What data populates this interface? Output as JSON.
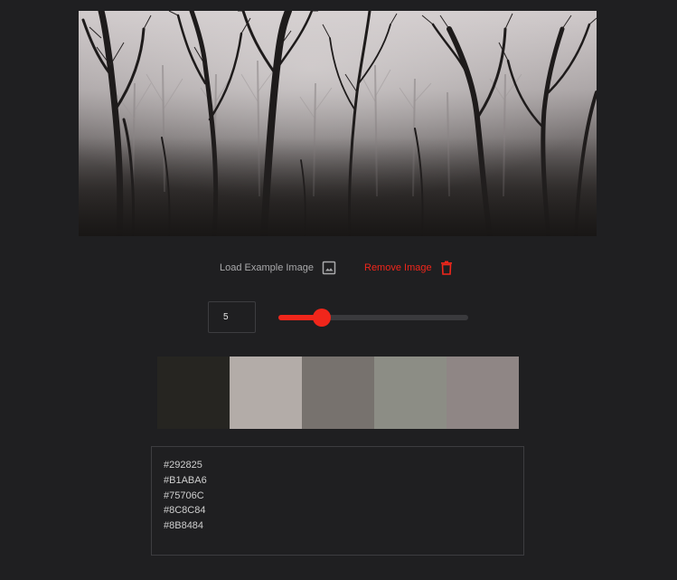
{
  "actions": {
    "load_label": "Load Example Image",
    "load_icon": "image-icon",
    "remove_label": "Remove Image",
    "remove_icon": "trash-icon"
  },
  "color_count": {
    "value": "5",
    "slider_fraction": 0.23
  },
  "palette": [
    {
      "hex": "#292825",
      "swatch": "#262521"
    },
    {
      "hex": "#B1ABA6",
      "swatch": "#b3aca8"
    },
    {
      "hex": "#75706C",
      "swatch": "#77726e"
    },
    {
      "hex": "#8C8C84",
      "swatch": "#8c8d85"
    },
    {
      "hex": "#8B8484",
      "swatch": "#8f8685"
    }
  ],
  "theme": {
    "accent": "#f0261b",
    "background": "#1f1f21"
  }
}
